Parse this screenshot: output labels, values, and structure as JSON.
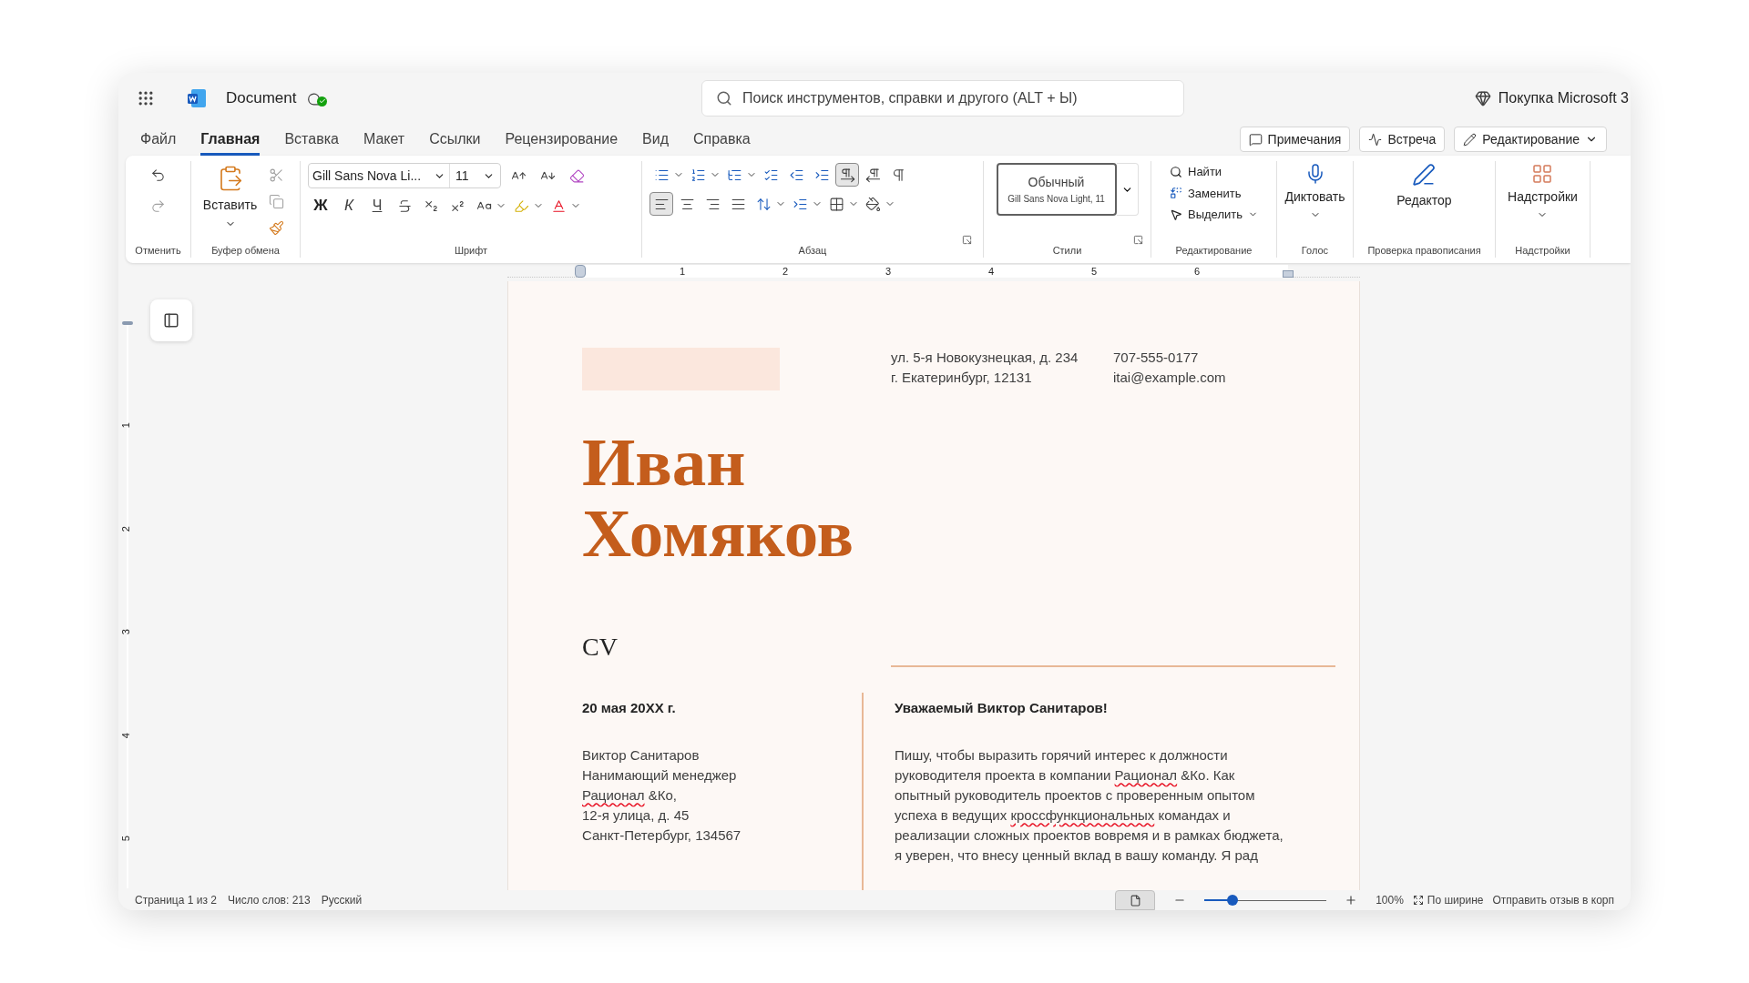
{
  "title_bar": {
    "document_name": "Document",
    "search": {
      "placeholder": "Поиск инструментов, справки и другого (ALT + Ы)"
    },
    "purchase_link": "Покупка Microsoft 3"
  },
  "tabs": [
    {
      "label": "Файл",
      "selected": false
    },
    {
      "label": "Главная",
      "selected": true
    },
    {
      "label": "Вставка",
      "selected": false
    },
    {
      "label": "Макет",
      "selected": false
    },
    {
      "label": "Ссылки",
      "selected": false
    },
    {
      "label": "Рецензирование",
      "selected": false
    },
    {
      "label": "Вид",
      "selected": false
    },
    {
      "label": "Справка",
      "selected": false
    }
  ],
  "tab_actions": [
    "Примечания",
    "Встреча",
    "Редактирование"
  ],
  "ribbon": {
    "undo": {
      "label": "Отменить"
    },
    "clipboard": {
      "label": "Буфер обмена",
      "paste": "Вставить"
    },
    "font": {
      "label": "Шрифт",
      "font_name": "Gill Sans Nova Li...",
      "font_size": "11",
      "bold": "Ж",
      "italic": "К",
      "underline": "Ч"
    },
    "paragraph": {
      "label": "Абзац",
      "text_direction": [
        {
          "selected": true
        },
        {
          "selected": false
        }
      ],
      "alignment": [
        {
          "selected": true
        },
        {
          "selected": false
        },
        {
          "selected": false
        },
        {
          "selected": false
        }
      ]
    },
    "styles": {
      "label": "Стили",
      "style_name": "Обычный",
      "style_font": "Gill Sans Nova Light, 11"
    },
    "editing": {
      "label": "Редактирование",
      "find": "Найти",
      "replace": "Заменить",
      "select": "Выделить"
    },
    "voice": {
      "label": "Голос",
      "dictate": "Диктовать"
    },
    "proofing": {
      "label": "Проверка правописания",
      "editor": "Редактор"
    },
    "addins": {
      "label": "Надстройки",
      "button": "Надстройки"
    }
  },
  "ruler": {
    "horizontal": [
      "1",
      "2",
      "3",
      "4",
      "5",
      "6"
    ],
    "vertical": [
      "1",
      "2",
      "3",
      "4",
      "5"
    ]
  },
  "document": {
    "sender_address": [
      "ул. 5-я Новокузнецкая, д. 234",
      "г. Екатеринбург, 12131"
    ],
    "sender_contact": [
      "707-555-0177",
      "itai@example.com"
    ],
    "name_lines": [
      "Иван",
      "Хомяков"
    ],
    "doc_type": "CV",
    "date": "20 мая 20XX г.",
    "recipient": [
      [
        {
          "text": "Виктор Санитаров",
          "misspelled": false
        }
      ],
      [
        {
          "text": "Нанимающий менеджер",
          "misspelled": false
        }
      ],
      [
        {
          "text": "Рационал",
          "misspelled": true
        },
        {
          "text": " &Ко,",
          "misspelled": false
        }
      ],
      [
        {
          "text": "12-я улица, д. 45",
          "misspelled": false
        }
      ],
      [
        {
          "text": "Санкт-Петербург, 134567",
          "misspelled": false
        }
      ]
    ],
    "greeting": "Уважаемый Виктор Санитаров!",
    "body": [
      [
        {
          "text": "Пишу, чтобы выразить горячий интерес к должности",
          "misspelled": false
        }
      ],
      [
        {
          "text": "руководителя проекта в компании ",
          "misspelled": false
        },
        {
          "text": "Рационал",
          "misspelled": true
        },
        {
          "text": " &Ко. Как",
          "misspelled": false
        }
      ],
      [
        {
          "text": "опытный руководитель проектов с проверенным опытом",
          "misspelled": false
        }
      ],
      [
        {
          "text": "успеха в ведущих ",
          "misspelled": false
        },
        {
          "text": "кроссфункциональных",
          "misspelled": true
        },
        {
          "text": " командах и",
          "misspelled": false
        }
      ],
      [
        {
          "text": "реализации сложных проектов вовремя и в рамках бюджета,",
          "misspelled": false
        }
      ],
      [
        {
          "text": "я уверен, что внесу ценный вклад в вашу команду. Я рад",
          "misspelled": false
        }
      ]
    ]
  },
  "status_bar": {
    "page": "Страница 1 из 2",
    "words": "Число слов: 213",
    "language": "Русский",
    "view_selected": true,
    "zoom": {
      "level": 0.23
    },
    "zoom_percent": "100%",
    "fit": "По ширине",
    "feedback": "Отправить отзыв в корп"
  }
}
